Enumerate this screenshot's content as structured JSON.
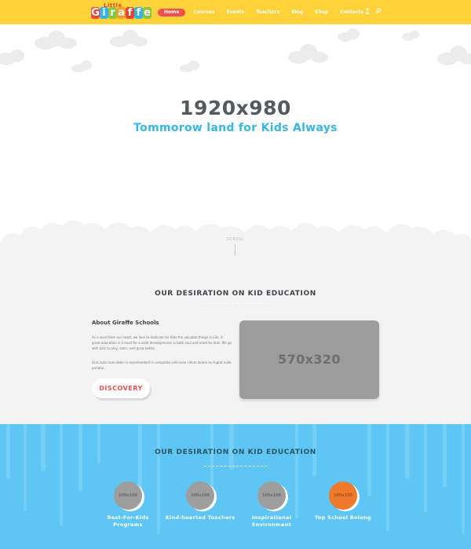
{
  "brand": {
    "logo_top": "Little",
    "logo_letters": [
      "G",
      "i",
      "r",
      "a",
      "f",
      "f",
      "e"
    ],
    "letter_colors": [
      "#f4483a",
      "#2fb5e6",
      "#8cc63f",
      "#f7a226",
      "#e8422f",
      "#2fb5e6",
      "#8cc63f"
    ]
  },
  "nav": {
    "items": [
      {
        "label": "Home",
        "active": true
      },
      {
        "label": "Courses",
        "active": false
      },
      {
        "label": "Events",
        "active": false
      },
      {
        "label": "Teachers",
        "active": false
      },
      {
        "label": "Blog",
        "active": false
      },
      {
        "label": "Shop",
        "active": false
      },
      {
        "label": "Contacts",
        "active": false
      }
    ],
    "icons": [
      "user-icon",
      "search-icon"
    ]
  },
  "hero": {
    "image_size": "1920x980",
    "tagline": "Tommorow land for Kids Always",
    "scroll_label": "SCROLL"
  },
  "about_section": {
    "heading": "OUR DESIRATION ON KID EDUCATION",
    "title": "About Giraffe Schools",
    "paragraph1": "As a word from our heart, we love to dedicate for Kids the valuable things in Life. A great education is a must for a solid developments in both soul and mind for kids. We go with kids to play, learn, and grow better.",
    "paragraph2": "Duis aute irure dolor in reprehenderit in voluptate velit esse cillum dolore eu fugiat nulla pariatur.",
    "button": "DISCOVERY",
    "image_placeholder": "570x320"
  },
  "features_section": {
    "heading": "OUR DESIRATION ON KID EDUCATION",
    "items": [
      {
        "image": "100x100",
        "label": "Best-For-Kids Programs",
        "highlight": false
      },
      {
        "image": "100x100",
        "label": "Kind-hearted Teachers",
        "highlight": false
      },
      {
        "image": "100x100",
        "label": "Inspirational Environment",
        "highlight": false
      },
      {
        "image": "100x100",
        "label": "Top School Belong",
        "highlight": true
      }
    ]
  },
  "colors": {
    "header_bg": "#ffd23a",
    "nav_active": "#ef4f4f",
    "accent_blue": "#35b7e8",
    "section_blue": "#5ec6f5",
    "button_text": "#e8524a"
  }
}
